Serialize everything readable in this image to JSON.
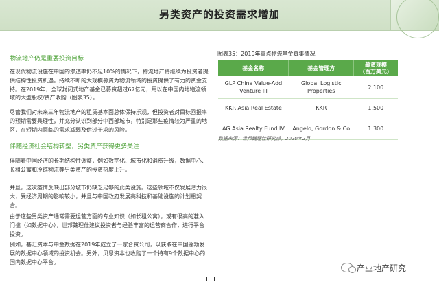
{
  "header": {
    "title": "另类资产的投资需求增加"
  },
  "left": {
    "heading1": "物流地产仍是重要投资目标",
    "para1": "在现代物流设施在中国的渗透率仍不足10%的情况下，物流地产将继续为投资者提供结构性投资机遇。持续不断的大规模募资为物流领域的投资提供了有力的资金支持。在2019年，全球封闭式地产基金已募资超过67亿元，用以在中国内地物流领域的大型股权/资产收购（图表35）。",
    "para2": "尽管我们对未来三年物流地产的租赁基本面总体保持乐观，但投资者对目标回报率的预期需要具理性，并充分认识到部分中西部城市，特别是那些疫情较为严重的地区，在短期内面临的需求减弱及供过于求的风险。",
    "heading2": "伴随经济社会结构转型，另类资产获得更多关注",
    "para3": "伴随着中国经济的长期结构性调整，例如数字化、城市化和消费升级，数据中心、长租公寓和冷链物流等另类资产的投资热度上升。",
    "para4": "并且，这次疫情反映出部分城市仍缺乏足够的此类设施。这些领域不仅发展潜力很大，受经济周期的影响较小，并且与中国政府发展高科技和基础设施的计划相契合。",
    "para5": "由于这些另类资产通常需要运营方面的专业知识（如长租公寓），或有很高的准入门槛（如数据中心），世邦魏理仕建议投资者与经验丰富的运营商合作，进行平台投资。",
    "para6": "例如，基汇资本与中金数据在2019年成立了一家合资公司，以获取在中国蓬勃发展的数据中心领域的投资机会。另外，贝恩资本也收购了一个持有9个数据中心的国内数据中心平台。"
  },
  "figure": {
    "title": "图表35：2019年重点物流基金募集情况",
    "columns": [
      "基金名称",
      "基金管理方",
      "募资规模\n（百万美元）"
    ],
    "rows": [
      [
        "GLP China Value-Add Venture III",
        "Global Logistic Properties",
        "2,100"
      ],
      [
        "KKR Asia Real Estate",
        "KKR",
        "1,500"
      ],
      [
        "AG Asia Realty Fund IV",
        "Angelo, Gordon & Co",
        "1,300"
      ]
    ],
    "source": "数据来源：世邦魏理仕研究部，2020年2月"
  },
  "watermark": {
    "text": "产业地产研究"
  }
}
